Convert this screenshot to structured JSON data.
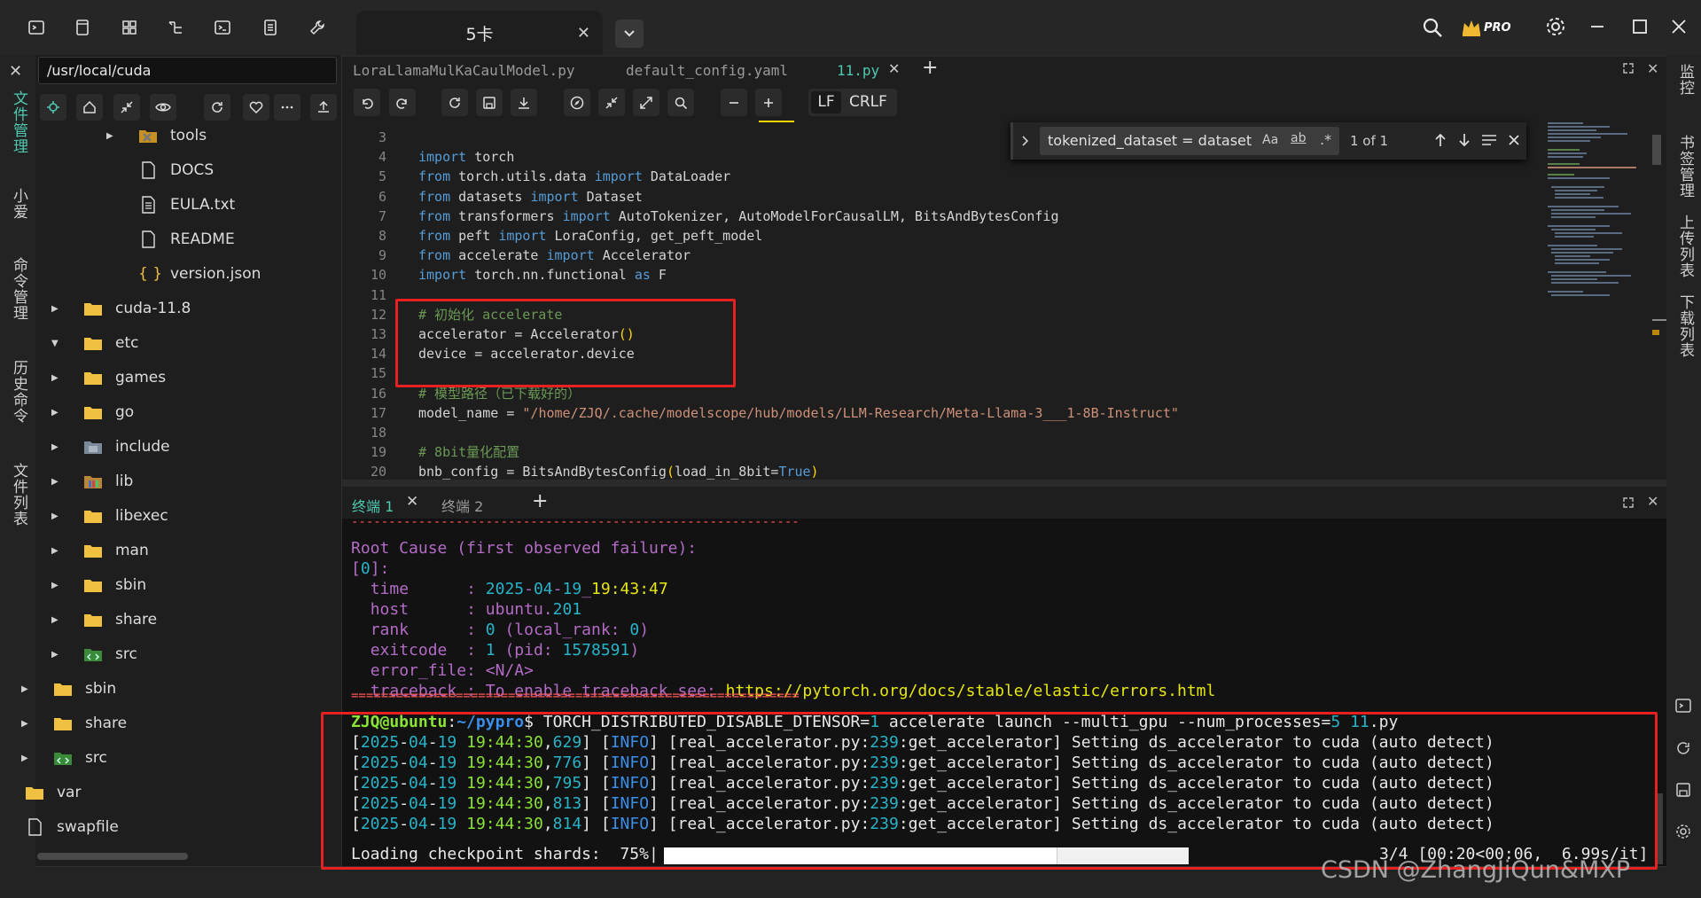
{
  "titlebar": {
    "tab_title": "5卡",
    "tab_close": "✕",
    "pro_badge": "PRO",
    "icons": [
      "terminal-icon",
      "file-icon",
      "grid-icon",
      "tree-icon",
      "shell-icon",
      "list-icon",
      "wrench-icon"
    ]
  },
  "left_bar": {
    "close": "✕",
    "items": [
      "文件管理",
      "小爱",
      "命令管理",
      "历史命令",
      "文件列表"
    ]
  },
  "right_bar": {
    "items": [
      "监控",
      "书签管理",
      "上传列表",
      "下载列表"
    ]
  },
  "sidebar": {
    "path": "/usr/local/cuda",
    "tree": [
      {
        "label": "tools",
        "icon": "tools",
        "caret": "right"
      },
      {
        "label": "DOCS",
        "icon": "file",
        "caret": ""
      },
      {
        "label": "EULA.txt",
        "icon": "text",
        "caret": ""
      },
      {
        "label": "README",
        "icon": "file",
        "caret": ""
      },
      {
        "label": "version.json",
        "icon": "json",
        "caret": ""
      },
      {
        "label": "cuda-11.8",
        "icon": "folder",
        "caret": "right"
      },
      {
        "label": "etc",
        "icon": "folder",
        "caret": "down"
      },
      {
        "label": "games",
        "icon": "folder",
        "caret": "right"
      },
      {
        "label": "go",
        "icon": "folder",
        "caret": "right"
      },
      {
        "label": "include",
        "icon": "include",
        "caret": "right"
      },
      {
        "label": "lib",
        "icon": "lib",
        "caret": "right"
      },
      {
        "label": "libexec",
        "icon": "folder",
        "caret": "right"
      },
      {
        "label": "man",
        "icon": "folder",
        "caret": "right"
      },
      {
        "label": "sbin",
        "icon": "folder",
        "caret": "right"
      },
      {
        "label": "share",
        "icon": "folder",
        "caret": "right"
      },
      {
        "label": "src",
        "icon": "src",
        "caret": "right"
      },
      {
        "label": "sbin",
        "icon": "folder",
        "caret": "right"
      },
      {
        "label": "share",
        "icon": "folder",
        "caret": "right"
      },
      {
        "label": "src",
        "icon": "src",
        "caret": "right"
      },
      {
        "label": "var",
        "icon": "folder",
        "caret": "right"
      },
      {
        "label": "swapfile",
        "icon": "file",
        "caret": ""
      }
    ]
  },
  "editor": {
    "tabs": [
      "LoraLlamaMulKaCaulModel.py",
      "default_config.yaml",
      "11.py"
    ],
    "eol": {
      "lf": "LF",
      "crlf": "CRLF"
    },
    "find": {
      "query": "tokenized_dataset = dataset",
      "aa": "Aa",
      "ab": "ab",
      "count": "1 of 1"
    },
    "code": [
      {
        "n": "3",
        "html": ""
      },
      {
        "n": "4",
        "html": "<span class='kw'>import</span> torch"
      },
      {
        "n": "5",
        "html": "<span class='kw'>from</span> torch.utils.data <span class='kw'>import</span> DataLoader"
      },
      {
        "n": "6",
        "html": "<span class='kw'>from</span> datasets <span class='kw'>import</span> Dataset"
      },
      {
        "n": "7",
        "html": "<span class='kw'>from</span> transformers <span class='kw'>import</span> AutoTokenizer, AutoModelForCausalLM, BitsAndBytesConfig"
      },
      {
        "n": "8",
        "html": "<span class='kw'>from</span> peft <span class='kw'>import</span> LoraConfig, get_peft_model"
      },
      {
        "n": "9",
        "html": "<span class='kw'>from</span> accelerate <span class='kw'>import</span> Accelerator"
      },
      {
        "n": "10",
        "html": "<span class='kw'>import</span> torch.nn.functional <span class='kw'>as</span> F"
      },
      {
        "n": "11",
        "html": ""
      },
      {
        "n": "12",
        "html": "<span class='cm'># 初始化 accelerate</span>"
      },
      {
        "n": "13",
        "html": "accelerator = Accelerator<span class='br'>()</span>"
      },
      {
        "n": "14",
        "html": "device = accelerator.device"
      },
      {
        "n": "15",
        "html": ""
      },
      {
        "n": "16",
        "html": "<span class='cm'># 模型路径（已下载好的）</span>"
      },
      {
        "n": "17",
        "html": "model_name = <span class='st'>\"/home/ZJQ/.cache/modelscope/hub/models/LLM-Research/Meta-Llama-3___1-8B-Instruct\"</span>"
      },
      {
        "n": "18",
        "html": ""
      },
      {
        "n": "19",
        "html": "<span class='cm'># 8bit量化配置</span>"
      },
      {
        "n": "20",
        "html": "bnb_config = BitsAndBytesConfig<span class='br'>(</span>load_in_8bit=<span class='kw'>True</span><span class='br'>)</span>"
      }
    ]
  },
  "terminal": {
    "tabs": [
      "终端 1",
      "终端 2"
    ],
    "lines": [
      "<span class='t-rd'>------------------------------------------------------------</span>",
      "<span class='t-mag'>Root Cause (first observed failure):</span>",
      "<span class='t-mag'>[</span><span class='t-cy'>0</span><span class='t-mag'>]:</span>",
      "  <span class='t-mag'>time</span>      <span class='t-mag'>:</span> <span class='t-cy'>2025</span><span class='t-mag'>-</span><span class='t-cy'>04</span><span class='t-mag'>-</span><span class='t-cy'>19</span><span class='t-mag'>_</span><span class='t-yl'>19:43:47</span>",
      "  <span class='t-mag'>host</span>      <span class='t-mag'>:</span> <span class='t-mag'>ubuntu.</span><span class='t-cy'>201</span>",
      "  <span class='t-mag'>rank</span>      <span class='t-mag'>:</span> <span class='t-cy'>0</span> <span class='t-mag'>(local_rank:</span> <span class='t-cy'>0</span><span class='t-mag'>)</span>",
      "  <span class='t-mag'>exitcode</span>  <span class='t-mag'>:</span> <span class='t-cy'>1</span> <span class='t-mag'>(pid:</span> <span class='t-cy'>1578591</span><span class='t-mag'>)</span>",
      "  <span class='t-mag'>error_file: &lt;N/A&gt;</span>",
      "  <span class='t-mag'>traceback : To enable traceback see:</span> <span class='t-yl'>https://pytorch.org/docs/stable/elastic/errors.html</span>",
      "<span class='t-rd'>============================================================</span>",
      "<span class='t-gr'><b>ZJQ@ubuntu</b></span>:<span class='t-bl'><b>~/pypro</b></span>$ TORCH_DISTRIBUTED_DISABLE_DTENSOR=<span class='t-cy'>1</span> accelerate launch --multi_gpu --num_processes=<span class='t-cy'>5</span> <span class='t-cy'>11</span>.py",
      "[<span class='t-cy'>2025</span>-<span class='t-cy'>04</span>-<span class='t-cy'>19</span> <span class='t-gr'>19:44:30</span>,<span class='t-cy'>629</span>] [<span class='t-bl'>INFO</span>] [real_accelerator.py:<span class='t-cy'>239</span>:get_accelerator] Setting ds_accelerator to cuda (auto detect)",
      "[<span class='t-cy'>2025</span>-<span class='t-cy'>04</span>-<span class='t-cy'>19</span> <span class='t-gr'>19:44:30</span>,<span class='t-cy'>776</span>] [<span class='t-bl'>INFO</span>] [real_accelerator.py:<span class='t-cy'>239</span>:get_accelerator] Setting ds_accelerator to cuda (auto detect)",
      "[<span class='t-cy'>2025</span>-<span class='t-cy'>04</span>-<span class='t-cy'>19</span> <span class='t-gr'>19:44:30</span>,<span class='t-cy'>795</span>] [<span class='t-bl'>INFO</span>] [real_accelerator.py:<span class='t-cy'>239</span>:get_accelerator] Setting ds_accelerator to cuda (auto detect)",
      "[<span class='t-cy'>2025</span>-<span class='t-cy'>04</span>-<span class='t-cy'>19</span> <span class='t-gr'>19:44:30</span>,<span class='t-cy'>813</span>] [<span class='t-bl'>INFO</span>] [real_accelerator.py:<span class='t-cy'>239</span>:get_accelerator] Setting ds_accelerator to cuda (auto detect)",
      "[<span class='t-cy'>2025</span>-<span class='t-cy'>04</span>-<span class='t-cy'>19</span> <span class='t-gr'>19:44:30</span>,<span class='t-cy'>814</span>] [<span class='t-bl'>INFO</span>] [real_accelerator.py:<span class='t-cy'>239</span>:get_accelerator] Setting ds_accelerator to cuda (auto detect)"
    ],
    "progress_label": "Loading checkpoint shards:  75%|",
    "progress_fraction": 0.75,
    "progress_tail": "3/4 [00:20<00:06,  6.99s/it]"
  },
  "watermark": "CSDN @ZhangJiQun&MXP",
  "colors": {
    "accent": "#4ec9b0",
    "highlight_box": "#e82020",
    "keyword": "#569cd6",
    "comment": "#6a9955",
    "string": "#ce9178"
  }
}
